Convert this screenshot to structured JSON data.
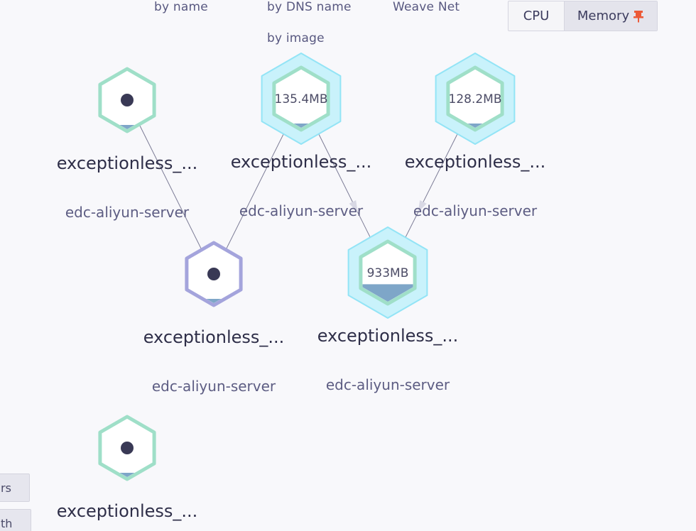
{
  "topology_options": {
    "by_name": "by name",
    "by_dns_name": "by DNS name",
    "weave_net": "Weave Net",
    "by_image": "by image"
  },
  "metric_selector": {
    "cpu_label": "CPU",
    "memory_label": "Memory",
    "selected": "Memory",
    "pinned_icon": "pin-icon",
    "pin_color": "#ec5a38"
  },
  "nodes": [
    {
      "id": "n1",
      "label": "exceptionless_...",
      "sublabel": "edc-aliyun-server",
      "metric": "",
      "shape": "hexagon",
      "border_color": "#9fdfc8",
      "highlighted": false,
      "fill_fraction": 0.06
    },
    {
      "id": "n2",
      "label": "exceptionless_...",
      "sublabel": "edc-aliyun-server",
      "metric": "135.4MB",
      "shape": "hexagon",
      "border_color": "#9fdfc8",
      "highlighted": true,
      "fill_fraction": 0.06
    },
    {
      "id": "n3",
      "label": "exceptionless_...",
      "sublabel": "edc-aliyun-server",
      "metric": "128.2MB",
      "shape": "hexagon",
      "border_color": "#9fdfc8",
      "highlighted": true,
      "fill_fraction": 0.06
    },
    {
      "id": "n4",
      "label": "exceptionless_...",
      "sublabel": "edc-aliyun-server",
      "metric": "",
      "shape": "hexagon",
      "border_color": "#a4a4dc",
      "highlighted": false,
      "fill_fraction": 0.06
    },
    {
      "id": "n5",
      "label": "exceptionless_...",
      "sublabel": "edc-aliyun-server",
      "metric": "933MB",
      "shape": "hexagon",
      "border_color": "#9fdfc8",
      "highlighted": true,
      "fill_fraction": 0.3
    },
    {
      "id": "n6",
      "label": "exceptionless_...",
      "sublabel": "",
      "metric": "",
      "shape": "hexagon",
      "border_color": "#9fdfc8",
      "highlighted": false,
      "fill_fraction": 0.06
    }
  ],
  "edges": [
    {
      "from": "n1",
      "to": "n4"
    },
    {
      "from": "n2",
      "to": "n4"
    },
    {
      "from": "n2",
      "to": "n5"
    },
    {
      "from": "n3",
      "to": "n5"
    }
  ],
  "side_controls": {
    "button_1_text": "rs",
    "button_2_text": "th"
  },
  "colors": {
    "background": "#f8f8fb",
    "highlight_halo": "#c9f2fb",
    "highlight_halo_stroke": "#93e4f6",
    "memory_fill": "#7ea6c8",
    "dot": "#393955"
  }
}
